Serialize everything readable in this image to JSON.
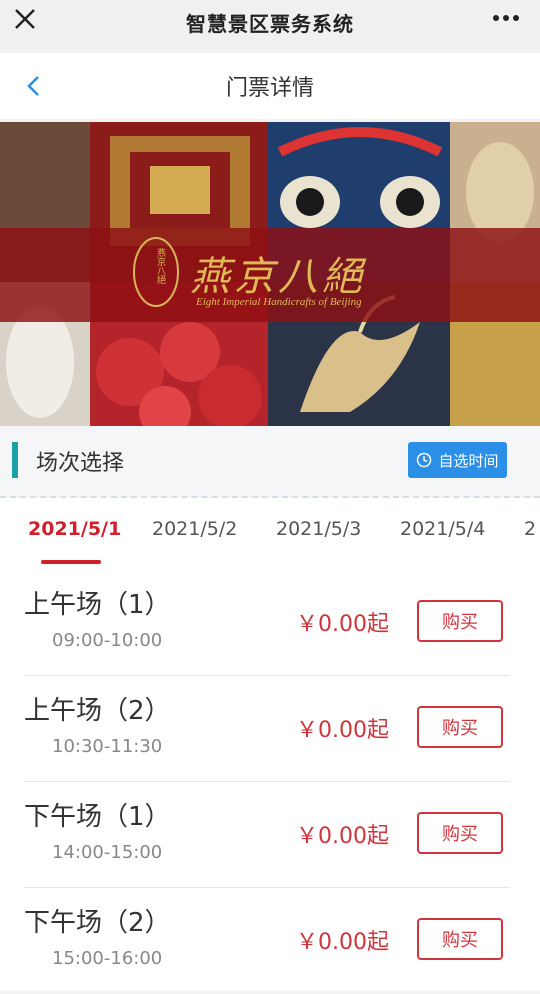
{
  "app": {
    "title": "智慧景区票务系统"
  },
  "nav": {
    "title": "门票详情"
  },
  "banner": {
    "calligraphy": "燕京八絕",
    "subtitle": "Eight Imperial Handicrafts of Beijing",
    "seal_text": "燕京八絕"
  },
  "section": {
    "label": "场次选择",
    "custom_time_label": "自选时间"
  },
  "dates": [
    {
      "label": "2021/5/1",
      "active": true
    },
    {
      "label": "2021/5/2",
      "active": false
    },
    {
      "label": "2021/5/3",
      "active": false
    },
    {
      "label": "2021/5/4",
      "active": false
    },
    {
      "label": "2",
      "active": false
    }
  ],
  "sessions": [
    {
      "name": "上午场（1）",
      "time": "09:00-10:00",
      "price": "￥0.00起",
      "buy_label": "购买"
    },
    {
      "name": "上午场（2）",
      "time": "10:30-11:30",
      "price": "￥0.00起",
      "buy_label": "购买"
    },
    {
      "name": "下午场（1）",
      "time": "14:00-15:00",
      "price": "￥0.00起",
      "buy_label": "购买"
    },
    {
      "name": "下午场（2）",
      "time": "15:00-16:00",
      "price": "￥0.00起",
      "buy_label": "购买"
    }
  ],
  "colors": {
    "accent": "#d01f2a",
    "button_blue": "#2b8fe8",
    "section_bar": "#1aa1a6"
  },
  "icons": {
    "close": "close-icon",
    "more": "more-icon",
    "back": "back-arrow-icon",
    "clock": "clock-icon"
  }
}
